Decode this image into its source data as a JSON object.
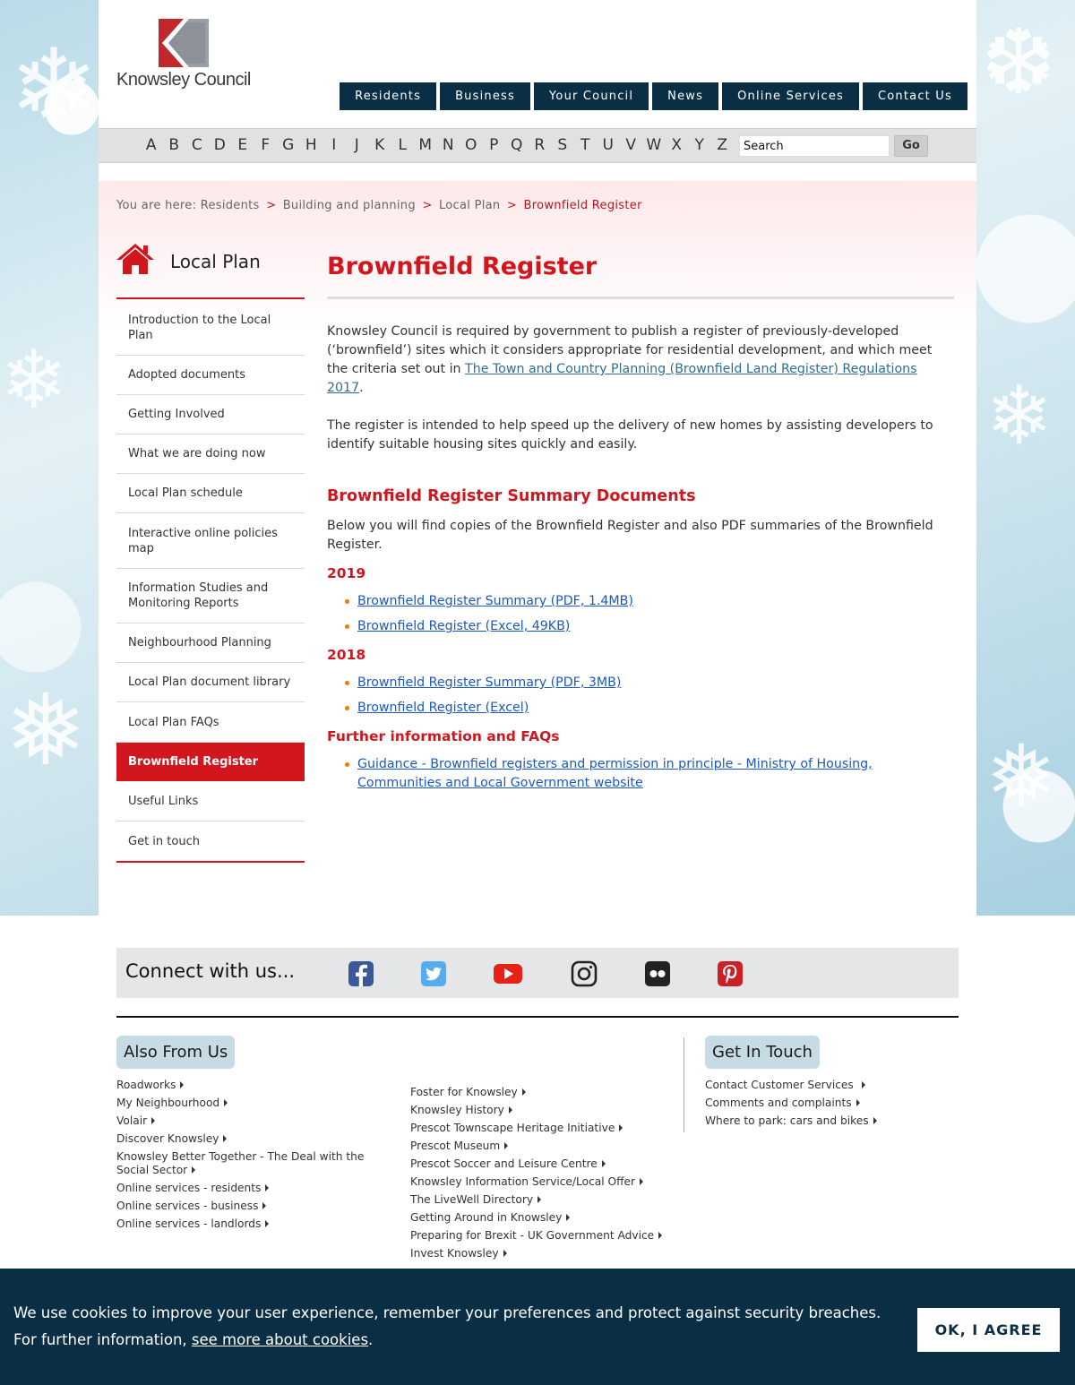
{
  "logo": {
    "text": "Knowsley Council"
  },
  "mainnav": [
    "Residents",
    "Business",
    "Your Council",
    "News",
    "Online Services",
    "Contact Us"
  ],
  "az": [
    "A",
    "B",
    "C",
    "D",
    "E",
    "F",
    "G",
    "H",
    "I",
    "J",
    "K",
    "L",
    "M",
    "N",
    "O",
    "P",
    "Q",
    "R",
    "S",
    "T",
    "U",
    "V",
    "W",
    "X",
    "Y",
    "Z"
  ],
  "search": {
    "value": "Search",
    "go": "Go"
  },
  "breadcrumb": {
    "prefix": "You are here:",
    "items": [
      "Residents",
      "Building and planning",
      "Local Plan"
    ],
    "current": "Brownfield Register",
    "separator": ">"
  },
  "sidebar": {
    "title": "Local Plan",
    "items": [
      "Introduction to the Local Plan",
      "Adopted documents",
      "Getting Involved",
      "What we are doing now",
      "Local Plan schedule",
      "Interactive online policies map",
      "Information Studies and Monitoring Reports",
      "Neighbourhood Planning",
      "Local Plan document library",
      "Local Plan FAQs",
      "Brownfield Register",
      "Useful Links",
      "Get in touch"
    ]
  },
  "main": {
    "title": "Brownfield Register",
    "intro_1": "Knowsley Council is required by government to publish a register of previously-developed (‘brownfield’) sites which it considers appropriate for residential development, and which meet the criteria set out in ",
    "intro_link": "The Town and Country Planning (Brownfield Land Register) Regulations 2017",
    "intro_end": ".",
    "para_2": "The register is intended to help speed up the delivery of new homes by assisting developers to identify suitable housing sites quickly and easily.",
    "summary_heading": "Brownfield Register Summary Documents",
    "summary_text": "Below you will find copies of the Brownfield Register and also PDF summaries of the Brownfield Register.",
    "year_2019": "2019",
    "links_2019": [
      "Brownfield Register Summary (PDF, 1.4MB)",
      "Brownfield Register (Excel, 49KB)"
    ],
    "year_2018": "2018",
    "links_2018": [
      "Brownfield Register Summary (PDF, 3MB)",
      "Brownfield Register (Excel)"
    ],
    "faq_heading": "Further information and FAQs",
    "faq_links": [
      "Guidance - Brownfield registers and permission in principle - Ministry of Housing, Communities and Local Government website"
    ]
  },
  "connect": {
    "label": "Connect with us...",
    "icons": [
      "facebook-icon",
      "twitter-icon",
      "youtube-icon",
      "instagram-icon",
      "flickr-icon",
      "pinterest-icon"
    ]
  },
  "footer": {
    "also_heading": "Also From Us",
    "also_col1": [
      "Roadworks",
      "My Neighbourhood",
      "Volair",
      "Discover Knowsley",
      "Knowsley Better Together - The Deal with the Social Sector",
      "Online services - residents",
      "Online services - business",
      "Online services - landlords"
    ],
    "also_col2": [
      "Foster for Knowsley",
      "Knowsley History",
      "Prescot Townscape Heritage Initiative",
      "Prescot Museum",
      "Prescot Soccer and Leisure Centre",
      "Knowsley Information Service/Local Offer",
      "The LiveWell Directory",
      "Getting Around in Knowsley",
      "Preparing for Brexit - UK Government Advice",
      "Invest Knowsley"
    ],
    "touch_heading": "Get In Touch",
    "touch_links": [
      "Contact Customer Services",
      "Comments and complaints",
      "Where to park: cars and bikes"
    ]
  },
  "cookie": {
    "message": "We use cookies to improve your user experience, remember your preferences and protect against security breaches. For further information, ",
    "link": "see more about cookies",
    "end": ".",
    "button": "OK, I AGREE"
  },
  "colors": {
    "brand_red": "#d2161e",
    "nav_navy": "#0a2f45",
    "link_blue": "#1a58c4",
    "bullet_orange": "#f07d00",
    "pill_blue": "#c7dbe5"
  }
}
